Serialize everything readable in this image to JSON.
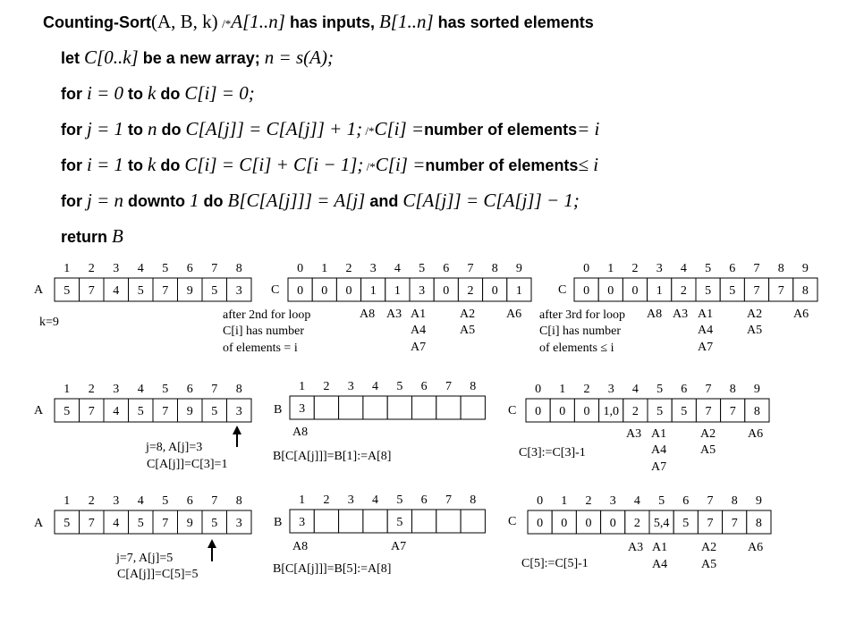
{
  "algorithm": {
    "l1": {
      "name": "Counting-Sort",
      "args": "(A, B, k)",
      "c1": "/*",
      "a1": "A[1..n]",
      "t1": " has inputs, ",
      "b1": "B[1..n]",
      "t2": " has sorted elements"
    },
    "l2": {
      "k1": "let ",
      "x1": "C[0..k]",
      "k2": " be a new array; ",
      "x2": "n = s(A);"
    },
    "l3": {
      "k1": "for ",
      "x1": "i = 0",
      "k2": " to ",
      "x2": "k",
      "k3": " do ",
      "x3": "C[i] = 0;"
    },
    "l4": {
      "k1": "for ",
      "x1": "j = 1",
      "k2": " to ",
      "x2": "n",
      "k3": " do ",
      "x3": "C[A[j]] = C[A[j]] + 1;",
      "c": " /*",
      "x4": "C[i] =",
      "k4": "number of elements",
      "x5": "= i"
    },
    "l5": {
      "k1": "for ",
      "x1": "i = 1",
      "k2": " to ",
      "x2": "k",
      "k3": " do ",
      "x3": "C[i] = C[i] + C[i − 1];",
      "c": " /*",
      "x4": "C[i] =",
      "k4": "number of elements",
      "x5": "≤ i"
    },
    "l6": {
      "k1": "for ",
      "x1": "j = n",
      "k2": " downto ",
      "x2": "1",
      "k3": " do ",
      "x3": "B[C[A[j]]] = A[j]",
      "k4": " and ",
      "x4": "C[A[j]] = C[A[j]] − 1;"
    },
    "l7": {
      "k1": "return ",
      "x1": "B"
    }
  },
  "arrays": {
    "A_idx": [
      "1",
      "2",
      "3",
      "4",
      "5",
      "6",
      "7",
      "8"
    ],
    "A_val": [
      "5",
      "7",
      "4",
      "5",
      "7",
      "9",
      "5",
      "3"
    ],
    "C_idx": [
      "0",
      "1",
      "2",
      "3",
      "4",
      "5",
      "6",
      "7",
      "8",
      "9"
    ],
    "C_after2": [
      "0",
      "0",
      "0",
      "1",
      "1",
      "3",
      "0",
      "2",
      "0",
      "1"
    ],
    "C_after3": [
      "0",
      "0",
      "0",
      "1",
      "2",
      "5",
      "5",
      "7",
      "7",
      "8"
    ],
    "C_step1": [
      "0",
      "0",
      "0",
      "1,0",
      "2",
      "5",
      "5",
      "7",
      "7",
      "8"
    ],
    "C_step2": [
      "0",
      "0",
      "0",
      "0",
      "2",
      "5,4",
      "5",
      "7",
      "7",
      "8"
    ],
    "B_idx": [
      "1",
      "2",
      "3",
      "4",
      "5",
      "6",
      "7",
      "8"
    ],
    "B_step1": [
      "3",
      "",
      "",
      "",
      "",
      "",
      "",
      ""
    ],
    "B_step2": [
      "3",
      "",
      "",
      "",
      "5",
      "",
      "",
      ""
    ]
  },
  "labels": {
    "A": "A",
    "C": "C",
    "B": "B",
    "k": "k=9",
    "after2_1": "after 2nd for loop",
    "after2_2": "C[i] has number",
    "after2_3": "of elements = i",
    "after3_1": "after 3rd for loop",
    "after3_2": "C[i] has number",
    "after3_3": "of elements ≤ i",
    "ann2_a8": "A8",
    "ann2_a3": "A3",
    "ann2_a1": "A1",
    "ann2_a4": "A4",
    "ann2_a7": "A7",
    "ann2_a2": "A2",
    "ann2_a5": "A5",
    "ann2_a6": "A6",
    "s1_j": "j=8,  A[j]=3",
    "s1_c": "C[A[j]]=C[3]=1",
    "s1_b": "B[C[A[j]]]=B[1]:=A[8]",
    "s1_ba8": "A8",
    "s1_dec": "C[3]:=C[3]-1",
    "s2_j": "j=7,  A[j]=5",
    "s2_c": "C[A[j]]=C[5]=5",
    "s2_b": "B[C[A[j]]]=B[5]:=A[8]",
    "s2_ba8": "A8",
    "s2_ba7": "A7",
    "s2_dec": "C[5]:=C[5]-1"
  }
}
